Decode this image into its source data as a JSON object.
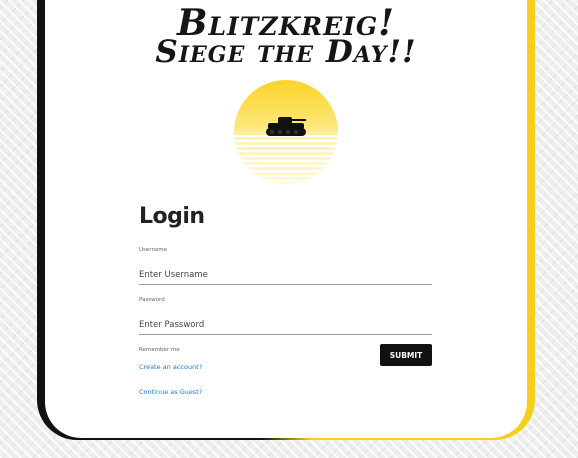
{
  "header": {
    "title_line1": "Blitzkreig!",
    "title_line2": "Siege the Day!!"
  },
  "logo": {
    "icon": "tank-icon",
    "sun_color": "#fbd428"
  },
  "login": {
    "heading": "Login",
    "username_label": "Username",
    "username_placeholder": "Enter Username",
    "password_label": "Password",
    "password_placeholder": "Enter Password",
    "remember_label": "Remember me",
    "submit_label": "SUBMIT",
    "create_account_label": "Create an account?",
    "guest_label": "Continue as Guest?"
  },
  "colors": {
    "accent_yellow": "#f6cf1d",
    "frame_black": "#111111",
    "link_blue": "#1a7fd0"
  }
}
